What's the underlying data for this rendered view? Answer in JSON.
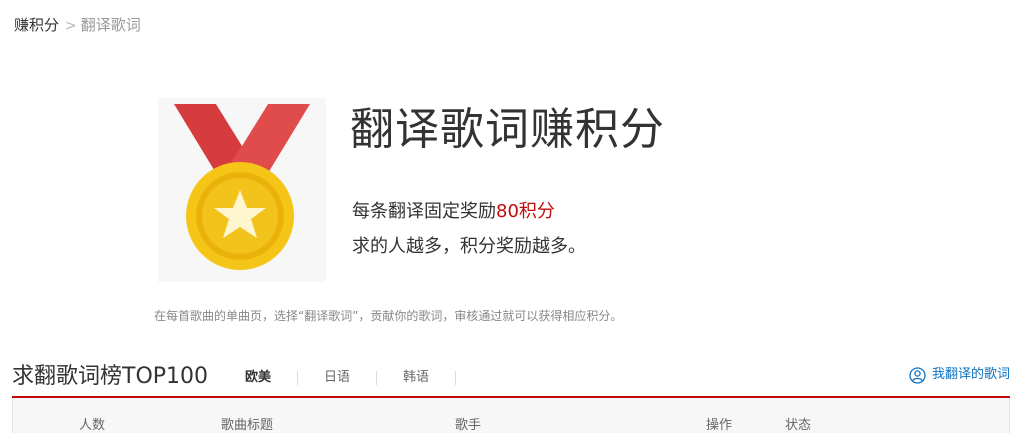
{
  "breadcrumb": {
    "parent": "赚积分",
    "separator": ">",
    "current": "翻译歌词"
  },
  "hero": {
    "title": "翻译歌词赚积分",
    "line1_prefix": "每条翻译固定奖励",
    "line1_points": "80积分",
    "line2": "求的人越多，积分奖励越多。",
    "medal_icon": "gold-star-medal-icon"
  },
  "note": "在每首歌曲的单曲页，选择“翻译歌词”，贡献你的歌词，审核通过就可以获得相应积分。",
  "ranking": {
    "title": "求翻歌词榜TOP100",
    "tabs": [
      {
        "label": "欧美",
        "active": true
      },
      {
        "label": "日语",
        "active": false
      },
      {
        "label": "韩语",
        "active": false
      }
    ],
    "my_translations_link": "我翻译的歌词"
  },
  "table": {
    "columns": [
      "人数",
      "歌曲标题",
      "歌手",
      "操作",
      "状态"
    ]
  },
  "colors": {
    "accent_red": "#c20c0c",
    "link_blue": "#0c73c2",
    "ribbon_red": "#d9383a",
    "medal_gold": "#f2c31a"
  }
}
